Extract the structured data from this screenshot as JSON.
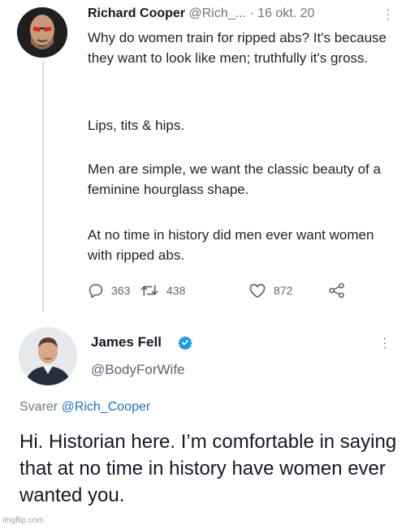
{
  "tweet1": {
    "author_name": "Richard Cooper",
    "author_handle": "@Rich_...",
    "separator": " · ",
    "date": "16 okt. 20",
    "more_glyph": "⋮",
    "paragraphs": [
      "Why do women train for ripped abs? It's because they want to look like men; truthfully it's gross.",
      "Lips, tits & hips.",
      "Men are simple, we want the classic beauty of a feminine hourglass shape.",
      "At no time in history did men ever want women with ripped abs."
    ],
    "actions": {
      "reply_count": "363",
      "retweet_count": "438",
      "like_count": "872"
    }
  },
  "tweet2": {
    "author_name": "James Fell",
    "author_handle": "@BodyForWife",
    "more_glyph": "⋮",
    "reply_prefix": "Svarer ",
    "reply_mention": "@Rich_Cooper",
    "text": "Hi. Historian here. I’m comfortable in saying that at no time in history have women ever wanted you."
  },
  "watermark": "imgflip.com",
  "colors": {
    "verified": "#1d9bf0",
    "mention": "#1d6fc2",
    "thread_line": "#cfd9de",
    "muted": "#6e767d"
  },
  "icons": [
    "reply-icon",
    "retweet-icon",
    "like-icon",
    "share-icon",
    "verified-badge-icon",
    "more-options-icon"
  ]
}
